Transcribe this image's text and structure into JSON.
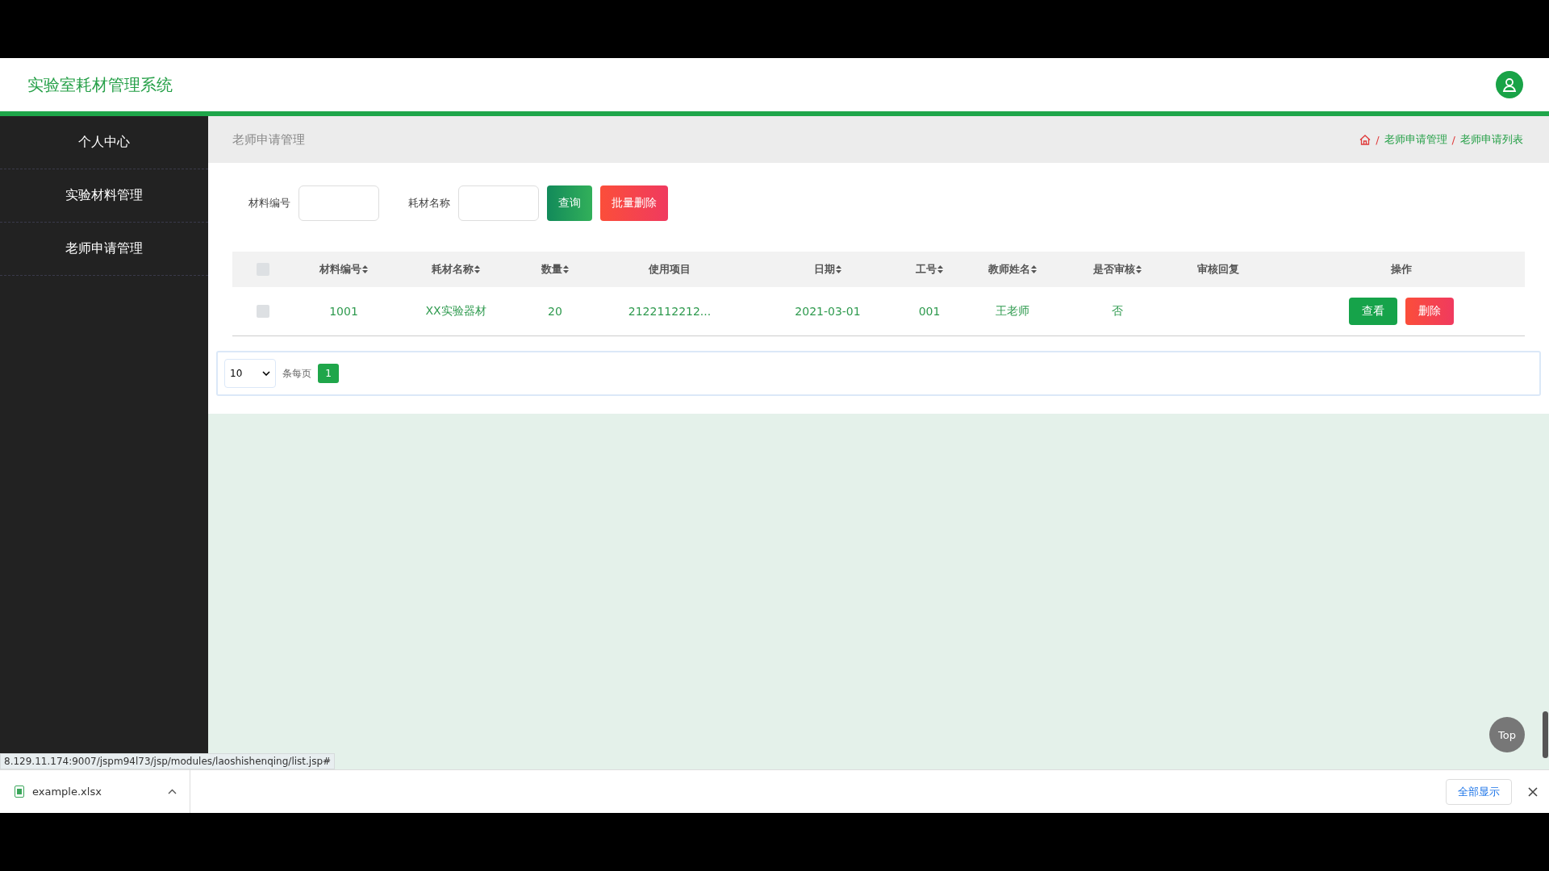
{
  "header": {
    "title": "实验室耗材管理系统"
  },
  "sidebar": {
    "items": [
      {
        "label": "个人中心",
        "selected": false
      },
      {
        "label": "实验材料管理",
        "selected": false
      },
      {
        "label": "老师申请管理",
        "selected": false
      }
    ]
  },
  "page_title": "老师申请管理",
  "breadcrumb": [
    {
      "separator": "/",
      "label": "老师申请管理"
    },
    {
      "separator": "/",
      "label": "老师申请列表"
    }
  ],
  "search": {
    "fields": [
      {
        "label": "材料编号"
      },
      {
        "label": "耗材名称"
      }
    ],
    "buttons": [
      {
        "label": "查询",
        "kind": "primary"
      },
      {
        "label": "批量删除",
        "kind": "danger"
      }
    ]
  },
  "table": {
    "select_all": {
      "checked": false
    },
    "columns": [
      {
        "label": "材料编号",
        "sortable": true
      },
      {
        "label": "耗材名称",
        "sortable": true
      },
      {
        "label": "数量",
        "sortable": true
      },
      {
        "label": "使用项目",
        "sortable": false
      },
      {
        "label": "日期",
        "sortable": true
      },
      {
        "label": "工号",
        "sortable": true
      },
      {
        "label": "教师姓名",
        "sortable": true
      },
      {
        "label": "是否审核",
        "sortable": true
      },
      {
        "label": "审核回复",
        "sortable": false
      },
      {
        "label": "操作",
        "sortable": false
      }
    ],
    "rows": [
      {
        "checked": false,
        "cells": [
          "1001",
          "XX实验器材",
          "20",
          "2122112212...",
          "2021-03-01",
          "001",
          "王老师",
          "否"
        ],
        "actions": [
          {
            "label": "查看",
            "kind": "primary"
          },
          {
            "label": "删除",
            "kind": "danger"
          }
        ]
      }
    ]
  },
  "pagination": {
    "page_size": "10",
    "page_size_label": "条每页",
    "pages": [
      {
        "label": "1",
        "selected": true
      }
    ]
  },
  "back_to_top": "Top",
  "status_url": "8.129.11.174:9007/jspm94l73/jsp/modules/laoshishenqing/list.jsp#",
  "download_bar": {
    "file": "example.xlsx",
    "show_all": "全部显示"
  }
}
